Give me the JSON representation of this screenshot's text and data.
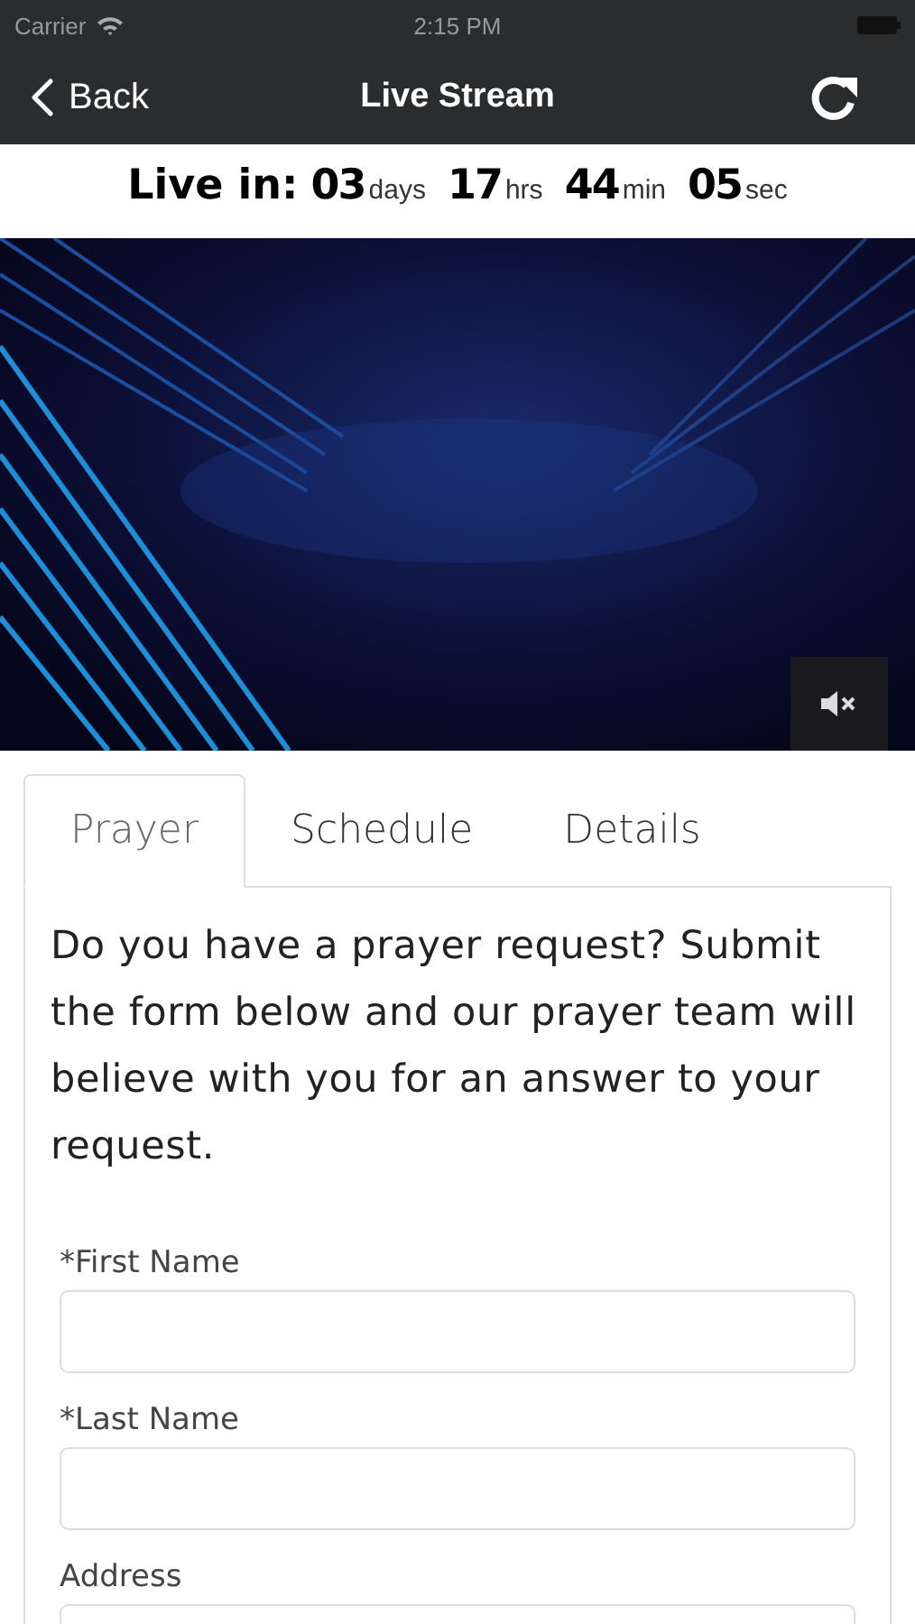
{
  "status_bar": {
    "carrier": "Carrier",
    "time": "2:15 PM"
  },
  "nav": {
    "back": "Back",
    "title": "Live Stream"
  },
  "countdown": {
    "label": "Live in:",
    "segments": [
      {
        "value": "03",
        "unit": "days"
      },
      {
        "value": "17",
        "unit": "hrs"
      },
      {
        "value": "44",
        "unit": "min"
      },
      {
        "value": "05",
        "unit": "sec"
      }
    ]
  },
  "video": {
    "kind": "picture",
    "muted": true
  },
  "tabs": [
    {
      "label": "Prayer",
      "selected": true
    },
    {
      "label": "Schedule",
      "selected": false
    },
    {
      "label": "Details",
      "selected": false
    }
  ],
  "intro": "Do you have a prayer request? Submit the form below and our prayer team will believe with you for an answer to your request.",
  "fields": [
    {
      "label": "*First Name"
    },
    {
      "label": "*Last Name"
    },
    {
      "label": "Address"
    }
  ]
}
